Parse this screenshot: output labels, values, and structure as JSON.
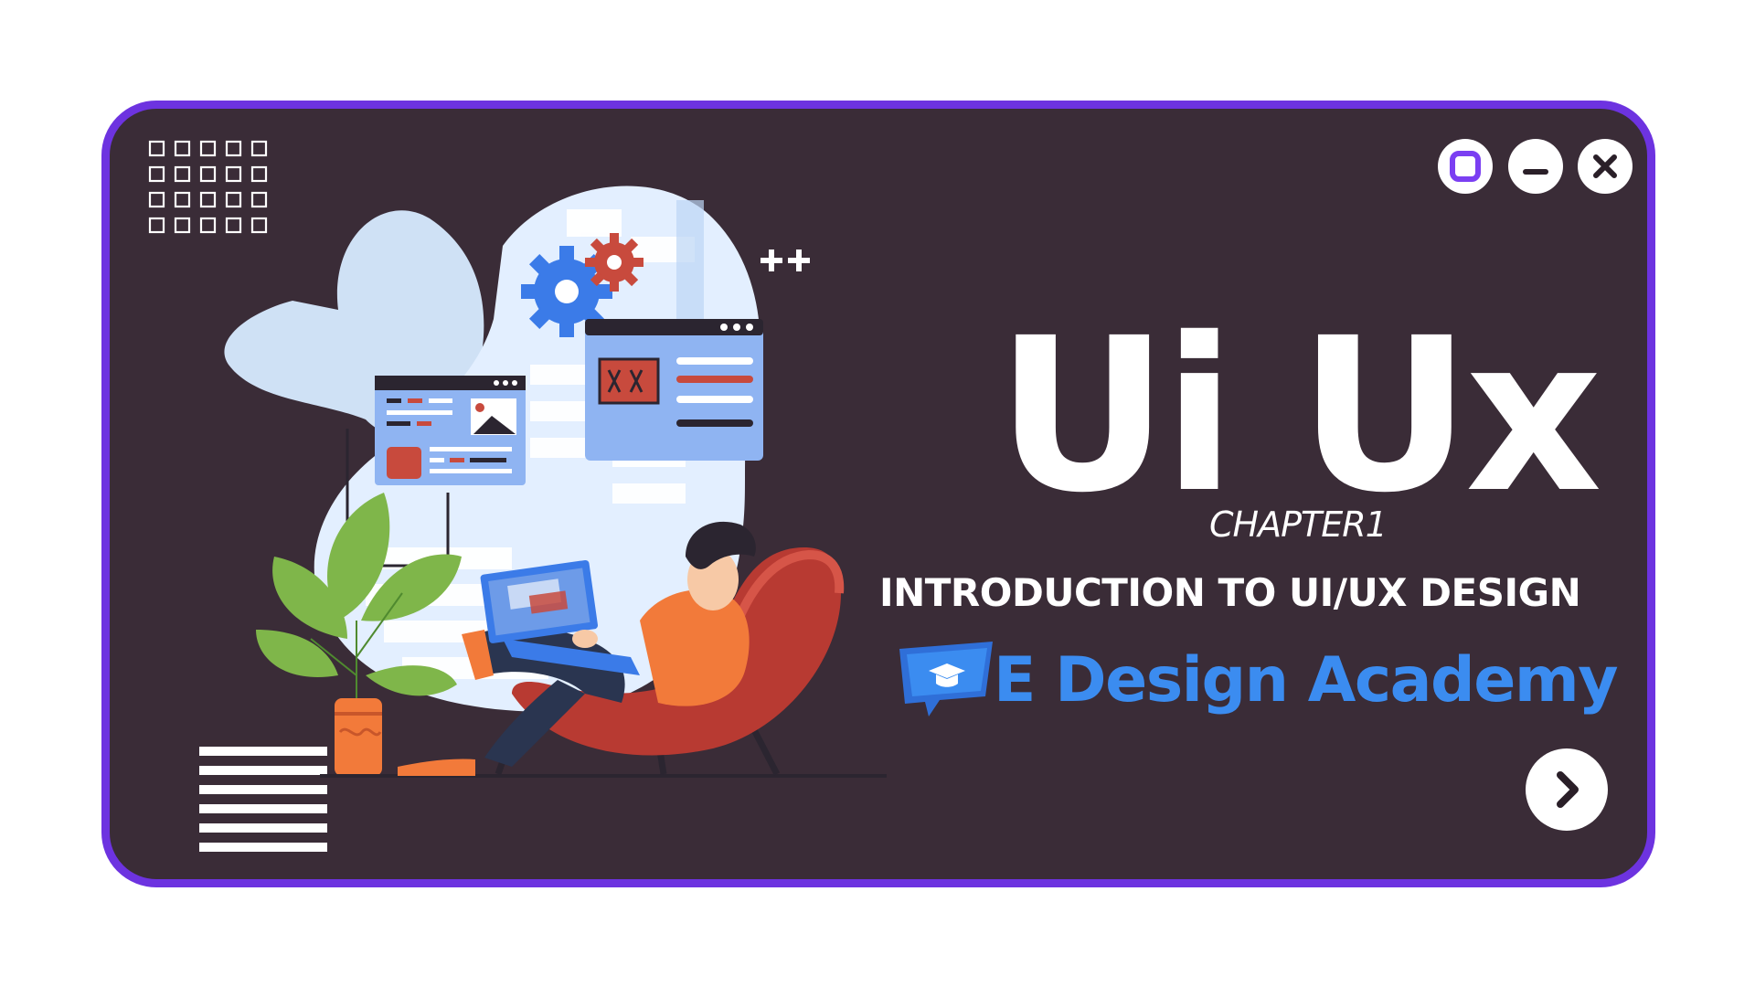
{
  "title": "Ui Ux",
  "chapter": "CHAPTER1",
  "subtitle": "INTRODUCTION TO UI/UX DESIGN",
  "brand": {
    "name": "E Design Academy",
    "logo_icon": "speech-bubble-graduation-cap-icon"
  },
  "window_controls": [
    {
      "name": "maximize",
      "icon": "square-icon"
    },
    {
      "name": "minimize",
      "icon": "minus-icon"
    },
    {
      "name": "close",
      "icon": "close-icon"
    }
  ],
  "navigation": {
    "next_icon": "chevron-right-icon"
  },
  "illustration": "man-on-lounge-chair-with-laptop",
  "colors": {
    "background": "#3a2c37",
    "border": "#6d33e0",
    "text": "#ffffff",
    "brand": "#3b8cf0",
    "chair": "#b83a32",
    "shirt": "#f27a3a",
    "panel": "#8fb4f2"
  }
}
